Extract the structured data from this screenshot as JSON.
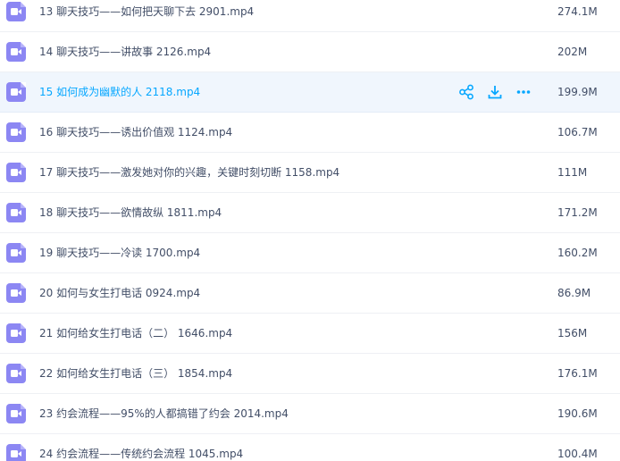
{
  "colors": {
    "accent": "#06a7ff",
    "video_icon": "#8c87f3",
    "text": "#424e67",
    "selected_row_bg": "#f0f6fd"
  },
  "files": [
    {
      "name": "13 聊天技巧——如何把天聊下去 2901.mp4",
      "size": "274.1M",
      "selected": false
    },
    {
      "name": "14 聊天技巧——讲故事 2126.mp4",
      "size": "202M",
      "selected": false
    },
    {
      "name": "15 如何成为幽默的人 2118.mp4",
      "size": "199.9M",
      "selected": true
    },
    {
      "name": "16 聊天技巧——诱出价值观 1124.mp4",
      "size": "106.7M",
      "selected": false
    },
    {
      "name": "17 聊天技巧——激发她对你的兴趣，关键时刻切断 1158.mp4",
      "size": "111M",
      "selected": false
    },
    {
      "name": "18 聊天技巧——欲情故纵 1811.mp4",
      "size": "171.2M",
      "selected": false
    },
    {
      "name": "19 聊天技巧——冷读 1700.mp4",
      "size": "160.2M",
      "selected": false
    },
    {
      "name": "20 如何与女生打电话 0924.mp4",
      "size": "86.9M",
      "selected": false
    },
    {
      "name": "21 如何给女生打电话（二） 1646.mp4",
      "size": "156M",
      "selected": false
    },
    {
      "name": "22 如何给女生打电话（三） 1854.mp4",
      "size": "176.1M",
      "selected": false
    },
    {
      "name": "23 约会流程——95%的人都搞错了约会 2014.mp4",
      "size": "190.6M",
      "selected": false
    },
    {
      "name": "24 约会流程——传统约会流程 1045.mp4",
      "size": "100.4M",
      "selected": false
    }
  ],
  "row_actions": [
    {
      "icon": "share-icon"
    },
    {
      "icon": "download-icon"
    },
    {
      "icon": "more-icon"
    }
  ]
}
